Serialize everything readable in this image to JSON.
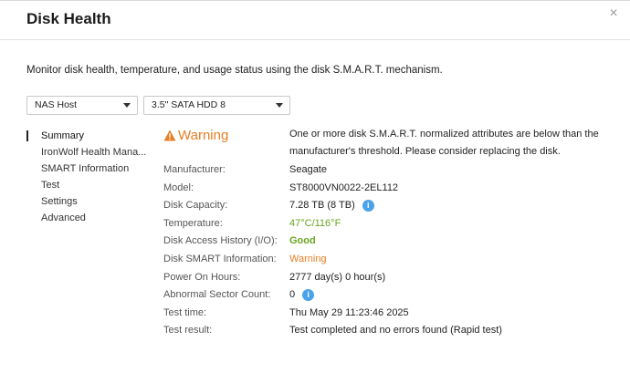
{
  "dialog": {
    "title": "Disk Health",
    "close_symbol": "×",
    "description": "Monitor disk health, temperature, and usage status using the disk S.M.A.R.T. mechanism."
  },
  "selectors": {
    "host": "NAS Host",
    "disk": "3.5\" SATA HDD 8"
  },
  "nav": {
    "items": [
      {
        "label": "Summary"
      },
      {
        "label": "IronWolf Health Mana..."
      },
      {
        "label": "SMART Information"
      },
      {
        "label": "Test"
      },
      {
        "label": "Settings"
      },
      {
        "label": "Advanced"
      }
    ],
    "active_index": 0
  },
  "summary": {
    "status": "Warning",
    "status_message": "One or more disk S.M.A.R.T. normalized attributes are below than the manufacturer's threshold. Please consider replacing the disk.",
    "rows": [
      {
        "label": "Manufacturer:",
        "value": "Seagate"
      },
      {
        "label": "Model:",
        "value": "ST8000VN0022-2EL112"
      },
      {
        "label": "Disk Capacity:",
        "value": "7.28 TB (8 TB)"
      },
      {
        "label": "Temperature:",
        "value": "47°C/116°F"
      },
      {
        "label": "Disk Access History (I/O):",
        "value": "Good"
      },
      {
        "label": "Disk SMART Information:",
        "value": "Warning"
      },
      {
        "label": "Power On Hours:",
        "value": "2777 day(s) 0 hour(s)"
      },
      {
        "label": "Abnormal Sector Count:",
        "value": "0"
      },
      {
        "label": "Test time:",
        "value": "Thu May 29 11:23:46 2025"
      },
      {
        "label": "Test result:",
        "value": "Test completed and no errors found (Rapid test)"
      }
    ]
  },
  "icons": {
    "info": "i",
    "warning": "warning-triangle-icon"
  },
  "colors": {
    "warning": "#e67e22",
    "good": "#6aa41e",
    "info": "#4aa3e8"
  }
}
